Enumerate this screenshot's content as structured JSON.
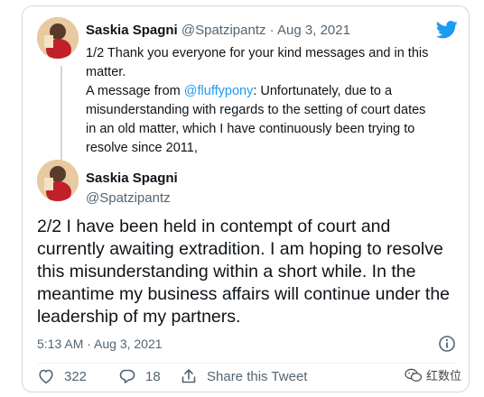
{
  "quoted_tweet": {
    "author_name": "Saskia Spagni",
    "author_handle": "@Spatzipantz",
    "separator": " · ",
    "date": "Aug 3, 2021",
    "text_line1": "1/2 Thank you everyone for your kind messages and in this matter.",
    "text_prefix": "A message from ",
    "mention": "@fluffypony",
    "text_rest": ": Unfortunately, due to a misunderstanding with regards to the setting of court dates in an old matter, which I have continuously been trying to resolve since 2011,"
  },
  "main_tweet": {
    "author_name": "Saskia Spagni",
    "author_handle": "@Spatzipantz",
    "text": "2/2 I have been held in contempt of court and currently awaiting extradition.  I am hoping to resolve this misunderstanding within a short while. In the meantime my business affairs will continue under the leadership of my partners.",
    "timestamp": "5:13 AM · Aug 3, 2021"
  },
  "actions": {
    "likes": "322",
    "replies": "18",
    "share_label": "Share this Tweet"
  },
  "watermark": {
    "text": "红数位"
  },
  "icons": {
    "brand": "twitter-bird-icon",
    "info": "info-icon",
    "like": "heart-icon",
    "reply": "reply-icon",
    "share": "share-icon",
    "watermark": "wechat-icon"
  },
  "colors": {
    "accent": "#1d9bf0",
    "text": "#0f1419",
    "muted": "#536471",
    "border": "#cfd9de"
  }
}
